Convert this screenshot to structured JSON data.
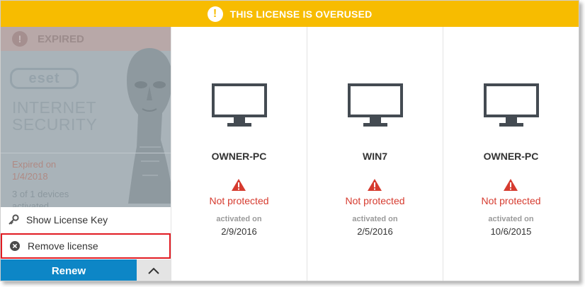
{
  "banner": {
    "text": "THIS LICENSE IS OVERUSED",
    "icon": "exclamation-icon",
    "color": "#f7bc00"
  },
  "license": {
    "status": "EXPIRED",
    "logo_text": "eset",
    "product_line1": "INTERNET",
    "product_line2": "SECURITY",
    "expired_line1": "Expired on",
    "expired_date": "1/4/2018",
    "devices_line1": "3 of 1 devices",
    "devices_line2": "activated"
  },
  "menu": {
    "items": [
      {
        "label": "Show License Key",
        "icon": "key-icon"
      },
      {
        "label": "Remove license",
        "icon": "remove-circle-icon"
      }
    ]
  },
  "actions": {
    "renew_label": "Renew",
    "collapse_icon": "chevron-up-icon",
    "renew_color": "#0d86c6"
  },
  "devices": [
    {
      "name": "OWNER-PC",
      "status": "Not protected",
      "activated_label": "activated on",
      "activated_date": "2/9/2016"
    },
    {
      "name": "WIN7",
      "status": "Not protected",
      "activated_label": "activated on",
      "activated_date": "2/5/2016"
    },
    {
      "name": "OWNER-PC",
      "status": "Not protected",
      "activated_label": "activated on",
      "activated_date": "10/6/2015"
    }
  ],
  "colors": {
    "status_red": "#d63b2f",
    "highlight_border": "#e11b22"
  }
}
